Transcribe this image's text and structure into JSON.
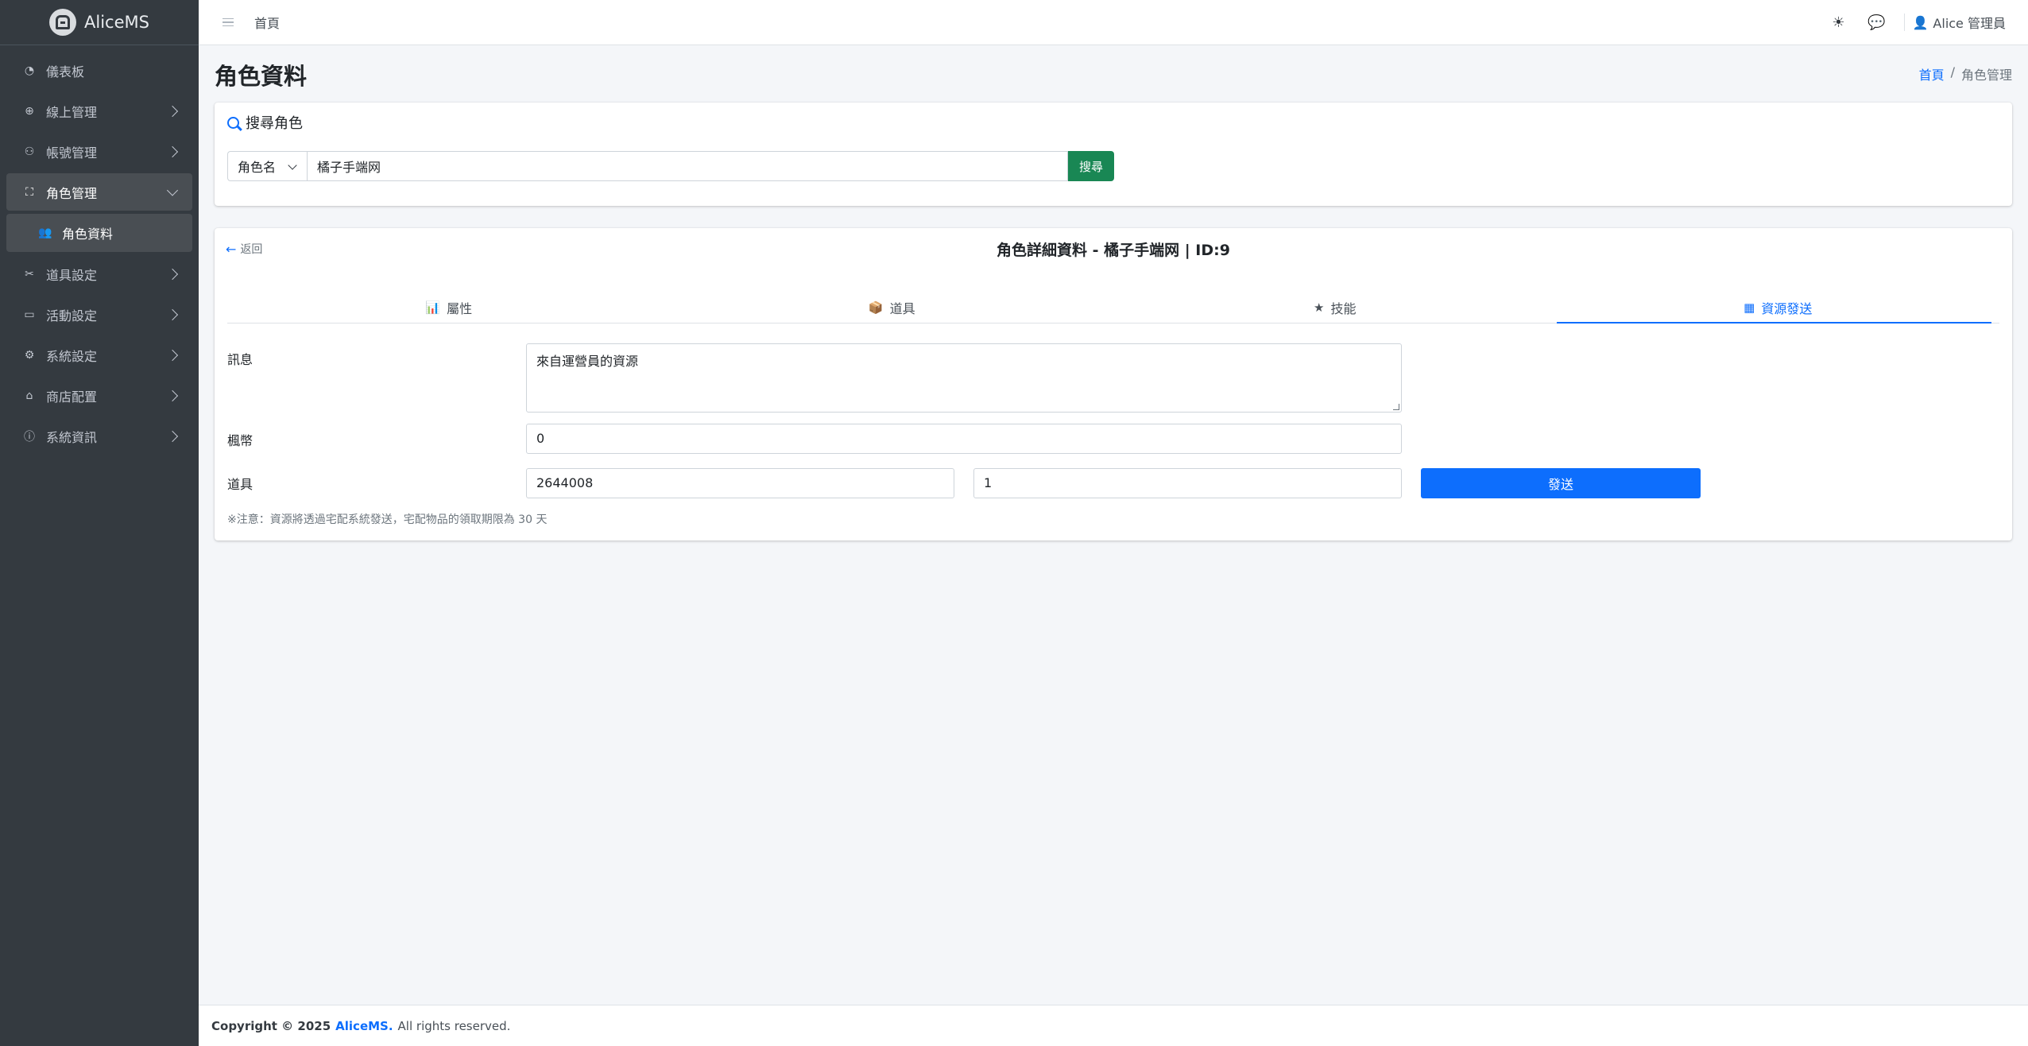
{
  "app": {
    "name": "AliceMS"
  },
  "sidebar": {
    "items": [
      {
        "label": "儀表板",
        "icon": "palette-icon"
      },
      {
        "label": "線上管理",
        "icon": "globe-icon"
      },
      {
        "label": "帳號管理",
        "icon": "user-group-icon"
      },
      {
        "label": "角色管理",
        "icon": "user-badge-icon"
      },
      {
        "label": "角色資料",
        "icon": "users-icon"
      },
      {
        "label": "道具設定",
        "icon": "tools-icon"
      },
      {
        "label": "活動設定",
        "icon": "calendar-icon"
      },
      {
        "label": "系統設定",
        "icon": "gear-icon"
      },
      {
        "label": "商店配置",
        "icon": "shop-icon"
      },
      {
        "label": "系統資訊",
        "icon": "info-icon"
      }
    ]
  },
  "header": {
    "home": "首頁",
    "user": "Alice 管理員"
  },
  "page": {
    "title": "角色資料",
    "breadcrumb": {
      "home": "首頁",
      "sep": "/",
      "current": "角色管理"
    }
  },
  "search": {
    "title": "搜尋角色",
    "select_value": "角色名",
    "input_value": "橘子手端网",
    "button": "搜尋"
  },
  "detail": {
    "back": "返回",
    "title": "角色詳細資料 - 橘子手端网 | ID:9",
    "tabs": [
      {
        "label": "屬性"
      },
      {
        "label": "道具"
      },
      {
        "label": "技能"
      },
      {
        "label": "資源發送"
      }
    ],
    "form": {
      "message_label": "訊息",
      "message_value": "來自運營員的資源",
      "currency_label": "楓幣",
      "currency_value": "0",
      "item_label": "道具",
      "item_id_value": "2644008",
      "item_qty_value": "1",
      "send_button": "發送",
      "note": "※注意：資源將透過宅配系統發送，宅配物品的領取期限為 30 天"
    }
  },
  "footer": {
    "copyright": "Copyright © 2025",
    "brand": "AliceMS.",
    "rights": "All rights reserved."
  },
  "colors": {
    "sidebar_bg": "#343a40",
    "primary": "#0d6efd",
    "success": "#198754"
  }
}
